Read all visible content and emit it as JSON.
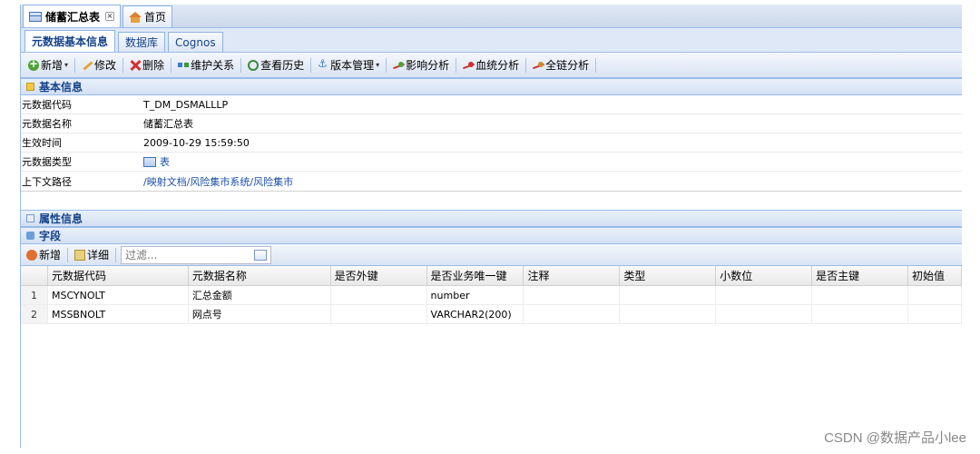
{
  "top_tabs": [
    {
      "label": "储蓄汇总表",
      "icon": "grid-icon",
      "closable": true,
      "active": true
    },
    {
      "label": "首页",
      "icon": "home-icon",
      "closable": false,
      "active": false
    }
  ],
  "sub_tabs": [
    {
      "label": "元数据基本信息",
      "active": true
    },
    {
      "label": "数据库",
      "active": false
    },
    {
      "label": "Cognos",
      "active": false
    }
  ],
  "toolbar": {
    "add": "新增",
    "edit": "修改",
    "delete": "删除",
    "maintain": "维护关系",
    "history": "查看历史",
    "version": "版本管理",
    "impact": "影响分析",
    "lineage": "血统分析",
    "full_chain": "全链分析"
  },
  "basic_info": {
    "title": "基本信息",
    "rows": [
      {
        "label": "元数据代码",
        "value": "T_DM_DSMALLLP"
      },
      {
        "label": "元数据名称",
        "value": "储蓄汇总表"
      },
      {
        "label": "生效时间",
        "value": "2009-10-29 15:59:50"
      },
      {
        "label": "元数据类型",
        "value": "表"
      },
      {
        "label": "上下文路径",
        "value": "/映射文档/风险集市系统/风险集市"
      }
    ]
  },
  "attr_info": {
    "title": "属性信息"
  },
  "fields": {
    "title": "字段",
    "add": "新增",
    "detail": "详细",
    "filter_placeholder": "过滤...",
    "columns": [
      "",
      "元数据代码",
      "元数据名称",
      "是否外键",
      "是否业务唯一键",
      "注释",
      "类型",
      "小数位",
      "是否主键",
      "初始值"
    ],
    "rows": [
      [
        "1",
        "MSCYNOLT",
        "汇总金额",
        "",
        "number",
        "",
        "",
        "",
        "",
        ""
      ],
      [
        "2",
        "MSSBNOLT",
        "网点号",
        "",
        "VARCHAR2(200)",
        "",
        "",
        "",
        "",
        ""
      ]
    ]
  },
  "watermark": "CSDN @数据产品小lee"
}
